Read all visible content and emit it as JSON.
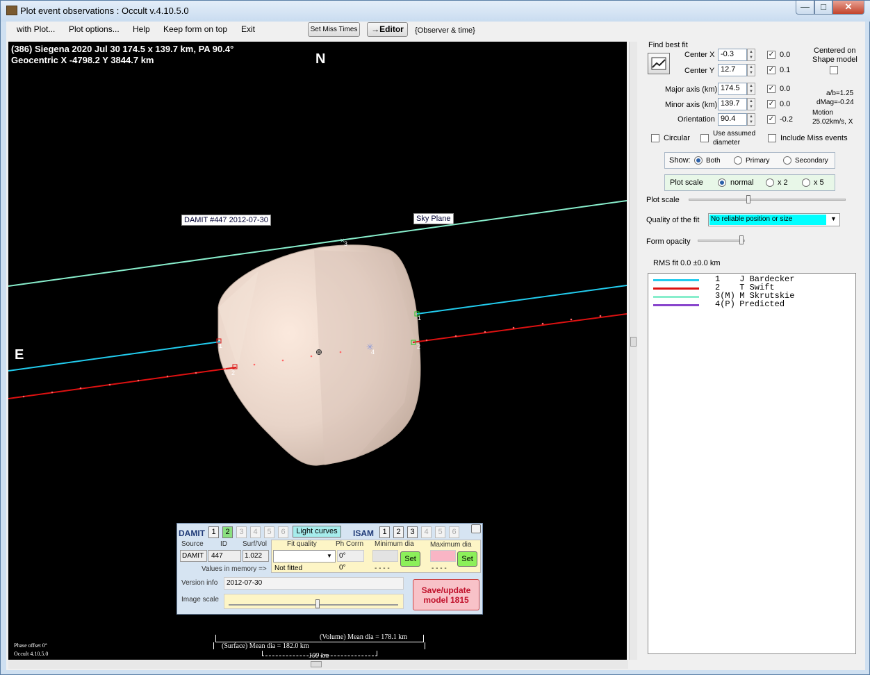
{
  "window": {
    "title": "Plot event observations : Occult v.4.10.5.0",
    "controls": {
      "minimize": "—",
      "maximize": "□",
      "close": "✕"
    }
  },
  "menu": {
    "items": [
      "with Plot...",
      "Plot options...",
      "Help",
      "Keep form on top",
      "Exit"
    ],
    "set_miss_times": "Set Miss Times",
    "editor": "→Editor",
    "observer_time": "{Observer & time}"
  },
  "plot": {
    "header_line1": "(386) Siegena  2020 Jul 30   174.5 x 139.7 km, PA 90.4°",
    "header_line2": "Geocentric  X  -4798.2  Y 3844.7 km",
    "north": "N",
    "east": "E",
    "damit_label": "DAMIT #447 2012-07-30",
    "sky_plane_label": "Sky Plane",
    "chord_labels": [
      "1",
      "1",
      "2",
      "2",
      "3",
      "4"
    ],
    "phase_offset": "Phase offset 0°",
    "version": "Occult 4.10.5.0",
    "volume_mean_dia": "(Volume) Mean dia = 178.1 km",
    "surface_mean_dia": "(Surface) Mean dia = 182.0 km",
    "scale_bar": "100 km",
    "colors": {
      "background": "#000000",
      "shape": "#e8d6cc",
      "chord1": "#22ccee",
      "chord2": "#dd1111",
      "chord3": "#88eecc",
      "predicted": "#8844cc"
    }
  },
  "fit": {
    "find_best_fit": "Find best fit",
    "center_x_label": "Center X",
    "center_x": "-0.3",
    "center_x_delta": "0.0",
    "center_y_label": "Center Y",
    "center_y": "12.7",
    "center_y_delta": "0.1",
    "centered_on": "Centered on",
    "shape_model": "Shape model",
    "major_label": "Major axis (km)",
    "major": "174.5",
    "major_delta": "0.0",
    "minor_label": "Minor axis (km)",
    "minor": "139.7",
    "minor_delta": "0.0",
    "orient_label": "Orientation",
    "orient": "90.4",
    "orient_delta": "-0.2",
    "ab_ratio": "a/b=1.25",
    "dmag": "dMag=-0.24",
    "motion": "Motion",
    "motion_value": "25.02km/s, X",
    "circular": "Circular",
    "use_assumed_1": "Use assumed",
    "use_assumed_2": "diameter",
    "include_miss": "Include Miss events"
  },
  "show": {
    "label": "Show:",
    "both": "Both",
    "primary": "Primary",
    "secondary": "Secondary"
  },
  "plot_scale_group": {
    "label": "Plot scale",
    "normal": "normal",
    "x2": "x 2",
    "x5": "x 5"
  },
  "sliders": {
    "plot_scale": "Plot scale",
    "form_opacity": "Form opacity"
  },
  "quality": {
    "label": "Quality of the fit",
    "value": "No reliable position or size"
  },
  "rms": "RMS fit 0.0 ±0.0 km",
  "legend": [
    {
      "num": "1",
      "flag": "",
      "name": "J Bardecker",
      "color": "#22ccee"
    },
    {
      "num": "2",
      "flag": "",
      "name": "T Swift",
      "color": "#dd1111"
    },
    {
      "num": "3",
      "flag": "(M)",
      "name": "M Skrutskie",
      "color": "#88eecc"
    },
    {
      "num": "4",
      "flag": "(P)",
      "name": "Predicted",
      "color": "#8844cc"
    }
  ],
  "damit": {
    "title": "DAMIT",
    "buttons": [
      "1",
      "2",
      "3",
      "4",
      "5",
      "6"
    ],
    "light_curves": "Light curves",
    "isam": "ISAM",
    "source_lbl": "Source",
    "id_lbl": "ID",
    "surfvol_lbl": "Surf/Vol",
    "source": "DAMIT",
    "id": "447",
    "surfvol": "1.022",
    "fit_quality_lbl": "Fit quality",
    "ph_corrn_lbl": "Ph Corrn",
    "ph_corrn": "0°",
    "min_dia_lbl": "Minimum dia",
    "max_dia_lbl": "Maximum dia",
    "set": "Set",
    "values_in_memory": "Values in memory =>",
    "not_fitted": "Not fitted",
    "ph_mem": "0°",
    "dashes": "- - - -",
    "version_info_lbl": "Version info",
    "version_info": "2012-07-30",
    "image_scale_lbl": "Image scale",
    "save_update": "Save/update",
    "model": "model 1815"
  }
}
